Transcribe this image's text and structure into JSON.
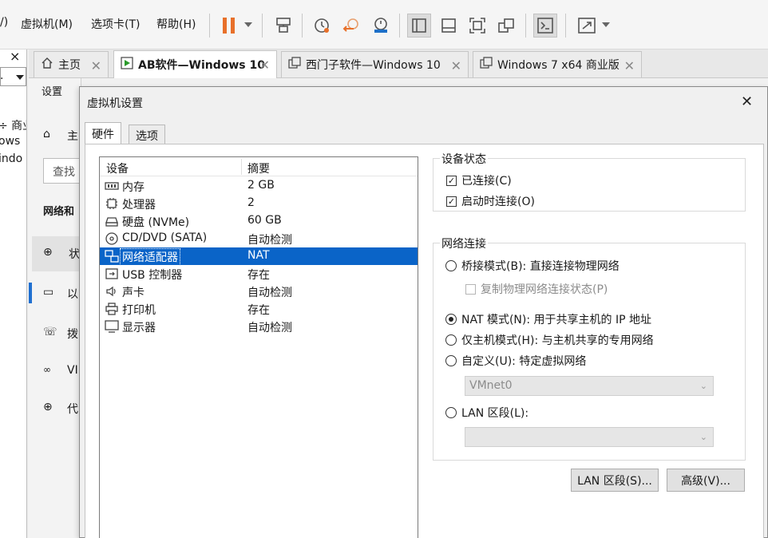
{
  "menu": {
    "items": [
      "/)",
      "虚拟机(M)",
      "选项卡(T)",
      "帮助(H)"
    ]
  },
  "left_snippets": {
    "close": "×",
    "dropdown": ".",
    "line1": "÷ 商业",
    "line2": "ows",
    "line3": "indo"
  },
  "behind": {
    "settings": "设置",
    "home": "主",
    "search": "查找",
    "network": "网络和",
    "item1": "状",
    "item2": "以",
    "item3": "拨",
    "item4": "VI",
    "item5": "代"
  },
  "tabs": [
    {
      "label": "主页",
      "icon": "home-icon"
    },
    {
      "label": "AB软件—Windows 10",
      "icon": "vm-running-icon"
    },
    {
      "label": "西门子软件—Windows 10",
      "icon": "vm-icon"
    },
    {
      "label": "Windows 7 x64 商业版",
      "icon": "vm-icon"
    }
  ],
  "dialog": {
    "title": "虚拟机设置",
    "tab_hardware": "硬件",
    "tab_options": "选项",
    "col_device": "设备",
    "col_summary": "摘要",
    "devices": [
      {
        "name": "内存",
        "summary": "2 GB",
        "icon": "memory-icon"
      },
      {
        "name": "处理器",
        "summary": "2",
        "icon": "cpu-icon"
      },
      {
        "name": "硬盘 (NVMe)",
        "summary": "60 GB",
        "icon": "disk-icon"
      },
      {
        "name": "CD/DVD (SATA)",
        "summary": "自动检测",
        "icon": "cd-icon"
      },
      {
        "name": "网络适配器",
        "summary": "NAT",
        "icon": "network-icon",
        "selected": true
      },
      {
        "name": "USB 控制器",
        "summary": "存在",
        "icon": "usb-icon"
      },
      {
        "name": "声卡",
        "summary": "自动检测",
        "icon": "sound-icon"
      },
      {
        "name": "打印机",
        "summary": "存在",
        "icon": "printer-icon"
      },
      {
        "name": "显示器",
        "summary": "自动检测",
        "icon": "display-icon"
      }
    ],
    "device_status": {
      "title": "设备状态",
      "connected": "已连接(C)",
      "connect_on_power": "启动时连接(O)"
    },
    "network": {
      "title": "网络连接",
      "bridged": "桥接模式(B): 直接连接物理网络",
      "replicate": "复制物理网络连接状态(P)",
      "nat": "NAT 模式(N): 用于共享主机的 IP 地址",
      "host_only": "仅主机模式(H): 与主机共享的专用网络",
      "custom": "自定义(U): 特定虚拟网络",
      "custom_value": "VMnet0",
      "lan": "LAN 区段(L):",
      "lan_value": ""
    },
    "btn_lan": "LAN 区段(S)...",
    "btn_advanced": "高级(V)..."
  },
  "colors": {
    "selection": "#0a64c8",
    "pause": "#e8702a"
  }
}
